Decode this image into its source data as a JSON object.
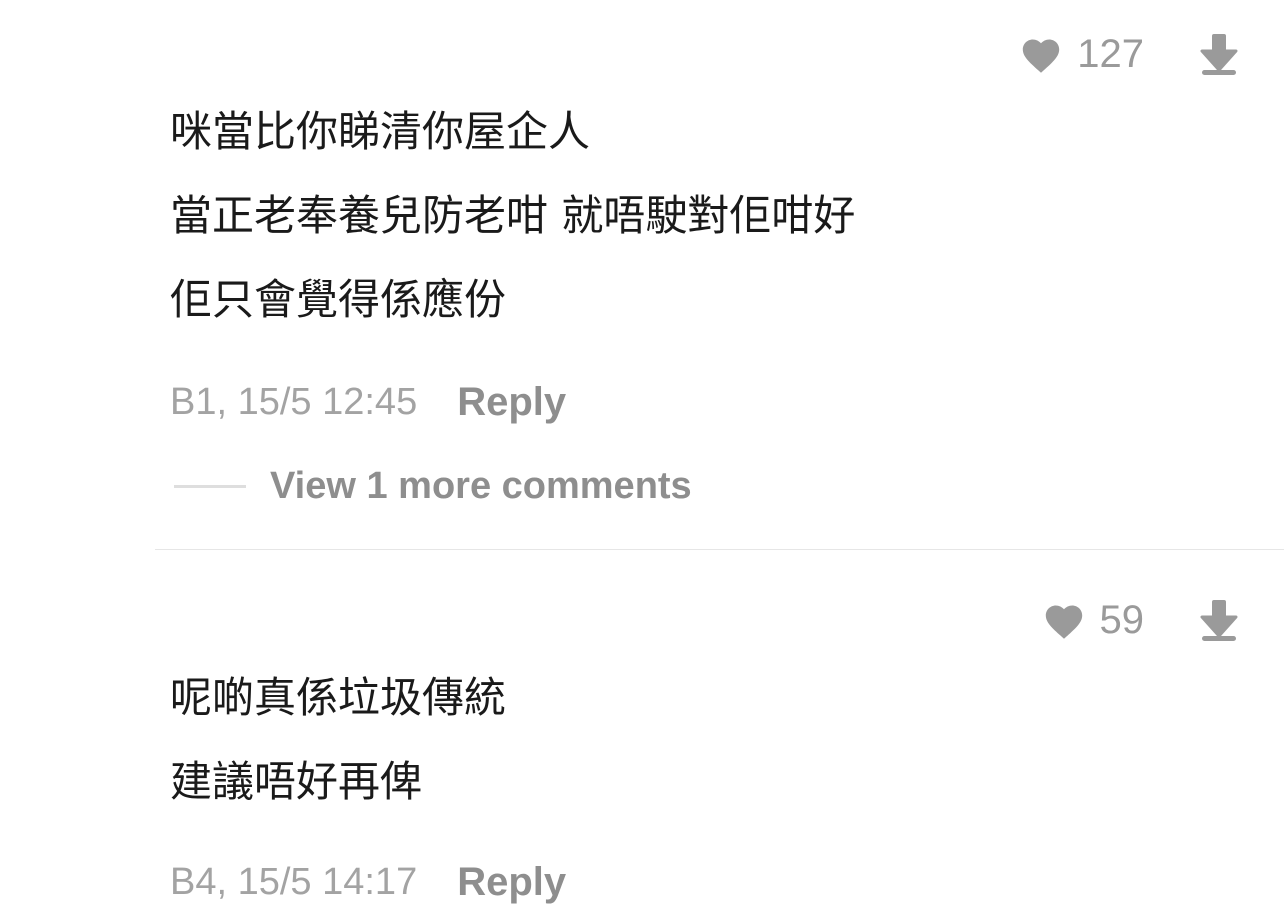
{
  "comments": [
    {
      "likes": "127",
      "lines": [
        "咪當比你睇清你屋企人",
        "當正老奉養兒防老咁 就唔駛對佢咁好",
        "佢只會覺得係應份"
      ],
      "timestamp": "B1, 15/5 12:45",
      "reply_label": "Reply",
      "view_more_label": "View 1 more comments"
    },
    {
      "likes": "59",
      "lines": [
        "呢啲真係垃圾傳統",
        "建議唔好再俾"
      ],
      "timestamp": "B4, 15/5 14:17",
      "reply_label": "Reply"
    }
  ],
  "icons": {
    "like": "heart-icon",
    "dislike": "arrow-down-icon"
  },
  "colors": {
    "icon_gray": "#9a9a9a",
    "text": "#1a1a1a",
    "meta": "#a3a3a3"
  }
}
